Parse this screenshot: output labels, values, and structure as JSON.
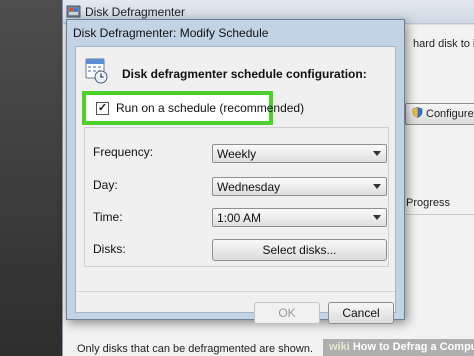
{
  "background_window": {
    "title": "Disk Defragmenter",
    "description_fragment": "hard disk to imp",
    "configure_button": "Configure sc",
    "progress_label": "Progress",
    "footer_text": "Only disks that can be defragmented are shown."
  },
  "dialog": {
    "title": "Disk Defragmenter: Modify Schedule",
    "header": "Disk defragmenter schedule configuration:",
    "schedule_checkbox": {
      "label": "Run on a schedule (recommended)",
      "checked": true,
      "check_glyph": "✓"
    },
    "fields": {
      "frequency": {
        "label": "Frequency:",
        "value": "Weekly"
      },
      "day": {
        "label": "Day:",
        "value": "Wednesday"
      },
      "time": {
        "label": "Time:",
        "value": "1:00 AM"
      },
      "disks": {
        "label": "Disks:",
        "button_label": "Select disks..."
      }
    },
    "buttons": {
      "ok": "OK",
      "cancel": "Cancel"
    }
  },
  "watermark": {
    "brand": "wiki",
    "text": "How to Defrag a Computer"
  },
  "colors": {
    "highlight": "#4ed02b",
    "dialog_frame": "#c3d3e6"
  }
}
